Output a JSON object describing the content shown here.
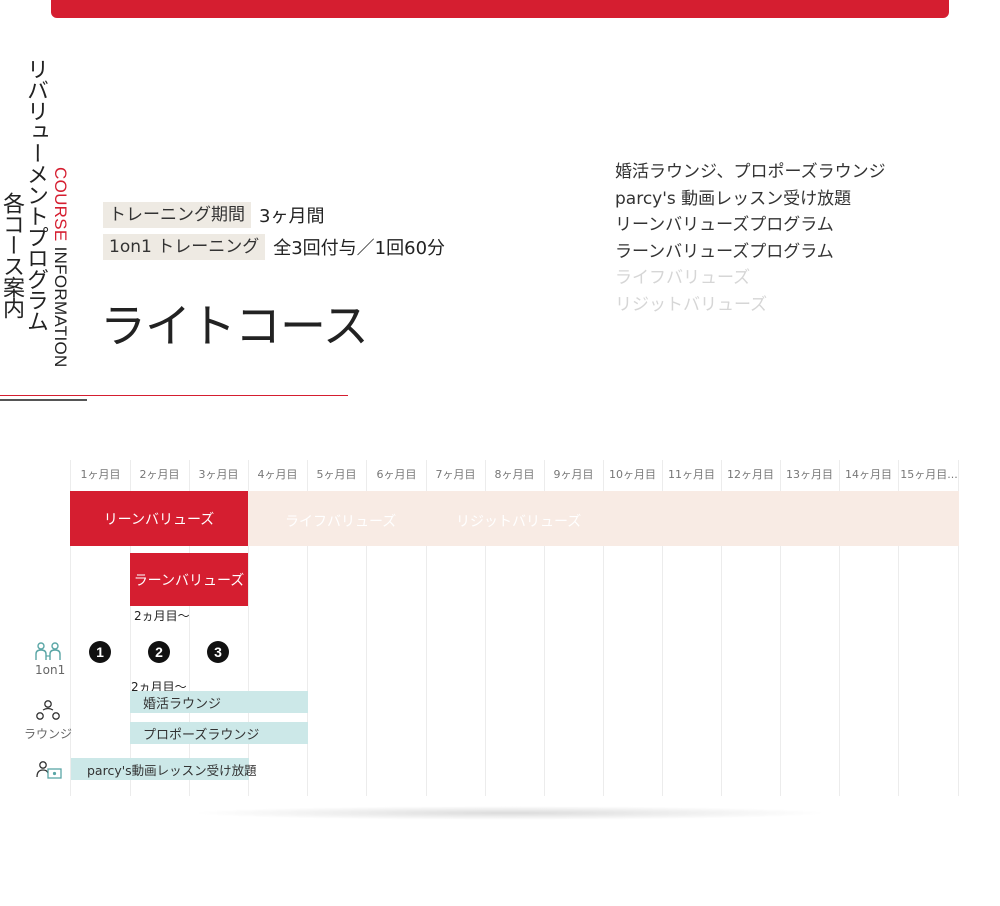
{
  "header": {
    "title_line1": "リバリューメントプログラム",
    "title_line2": "各コース案内",
    "en_part1": "COURSE",
    "en_part2": " INFORMATION"
  },
  "course": {
    "spec_rows": [
      {
        "key": "トレーニング期間",
        "value": "3ヶ月間"
      },
      {
        "key": "1on1 トレーニング",
        "value": "全3回付与／1回60分"
      }
    ],
    "name": "ライトコース",
    "features": [
      {
        "label": "婚活ラウンジ、プロポーズラウンジ",
        "included": true
      },
      {
        "label": "parcy's 動画レッスン受け放題",
        "included": true
      },
      {
        "label": "リーンバリューズプログラム",
        "included": true
      },
      {
        "label": "ラーンバリューズプログラム",
        "included": true
      },
      {
        "label": "ライフバリューズ",
        "included": false
      },
      {
        "label": "リジットバリューズ",
        "included": false
      }
    ]
  },
  "timeline": {
    "months": [
      "1ヶ月目",
      "2ヶ月目",
      "3ヶ月目",
      "4ヶ月目",
      "5ヶ月目",
      "6ヶ月目",
      "7ヶ月目",
      "8ヶ月目",
      "9ヶ月目",
      "10ヶ月目",
      "11ヶ月目",
      "12ヶ月目",
      "13ヶ月目",
      "14ヶ月目",
      "15ヶ月目..."
    ],
    "lean_values": "リーンバリューズ",
    "life_values": "ライフバリューズ",
    "rigid_values": "リジットバリューズ",
    "learn_values": "ラーンバリューズ",
    "from_month_2_a": "2ヵ月目〜",
    "from_month_2_b": "2ヵ月目〜",
    "sessions": [
      "1",
      "2",
      "3"
    ],
    "row_1on1_label": "1on1",
    "row_lounge_label": "ラウンジ",
    "konkatsu_lounge": "婚活ラウンジ",
    "propose_lounge": "プロポーズラウンジ",
    "video_lessons": "parcy's動画レッスン受け放題"
  },
  "colors": {
    "accent": "#d51e30",
    "band": "#f8ebe4",
    "teal": "#cce8e8",
    "spec_bg": "#eeeae3",
    "disabled": "#d6d6d6"
  }
}
